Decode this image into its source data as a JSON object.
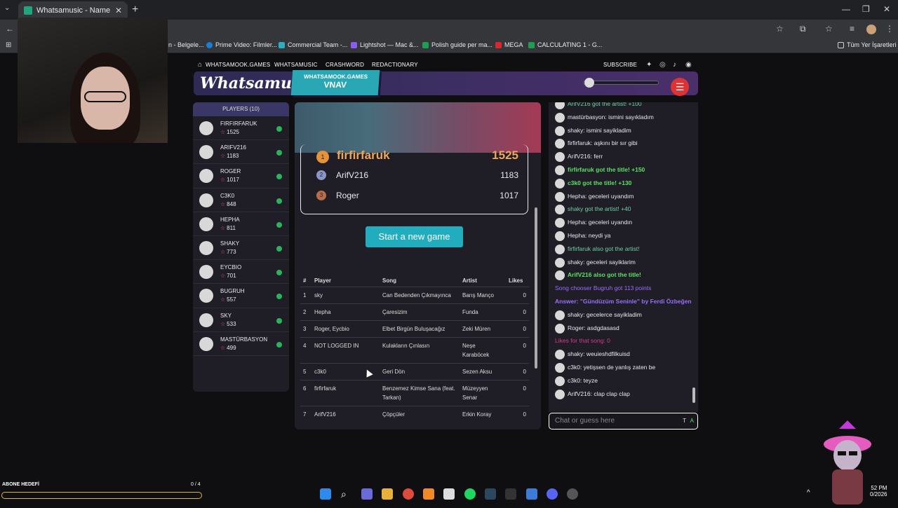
{
  "browser": {
    "tab_title": "Whatsamusic - Name That Tun",
    "new_tab": "+",
    "bookmarks": [
      {
        "label": "n - Belgele..."
      },
      {
        "label": "Prime Video: Filmler..."
      },
      {
        "label": "Commercial Team -..."
      },
      {
        "label": "Lightshot — Mac &..."
      },
      {
        "label": "Polish guide per ma..."
      },
      {
        "label": "MEGA"
      },
      {
        "label": "CALCULATING 1 - G..."
      },
      {
        "label": "Tüm Yer İşaretleri"
      }
    ]
  },
  "site_nav": {
    "links": [
      "WHATSAMOOK.GAMES",
      "WHATSAMUSIC",
      "CRASHWORD",
      "REDACTIONARY"
    ],
    "subscribe": "SUBSCRIBE"
  },
  "header": {
    "logo": "Whatsamusic",
    "room_site": "WHATSAMOOK.GAMES",
    "room_code": "VNAV"
  },
  "players": {
    "title": "PLAYERS (10)",
    "list": [
      {
        "name": "FIRFIRFARUK",
        "score": "1525"
      },
      {
        "name": "ARIFV216",
        "score": "1183"
      },
      {
        "name": "ROGER",
        "score": "1017"
      },
      {
        "name": "C3K0",
        "score": "848"
      },
      {
        "name": "HEPHA",
        "score": "811"
      },
      {
        "name": "SHAKY",
        "score": "773"
      },
      {
        "name": "EYCBIO",
        "score": "701"
      },
      {
        "name": "BUGRUH",
        "score": "557"
      },
      {
        "name": "SKY",
        "score": "533"
      },
      {
        "name": "MASTÜRBASYON",
        "score": "499"
      }
    ]
  },
  "podium": [
    {
      "rank": "1",
      "name": "firfirfaruk",
      "score": "1525"
    },
    {
      "rank": "2",
      "name": "ArifV216",
      "score": "1183"
    },
    {
      "rank": "3",
      "name": "Roger",
      "score": "1017"
    }
  ],
  "start_button": "Start a new game",
  "song_table": {
    "headers": [
      "#",
      "Player",
      "Song",
      "Artist",
      "Likes"
    ],
    "rows": [
      [
        "1",
        "sky",
        "Can Bedenden Çıkmayınca",
        "Barış Manço",
        "0"
      ],
      [
        "2",
        "Hepha",
        "Çaresizim",
        "Funda",
        "0"
      ],
      [
        "3",
        "Roger, Eycbio",
        "Elbet Birgün Buluşacağız",
        "Zeki Müren",
        "0"
      ],
      [
        "4",
        "NOT LOGGED IN",
        "Kulakların Çınlasın",
        "Neşe Karaböcek",
        "0"
      ],
      [
        "5",
        "c3k0",
        "Geri Dön",
        "Sezen Aksu",
        "0"
      ],
      [
        "6",
        "firfirfaruk",
        "Benzemez Kimse Sana (feat. Tarkan)",
        "Müzeyyen Senar",
        "0"
      ],
      [
        "7",
        "ArifV216",
        "Çöpçüler",
        "Erkin Koray",
        "0"
      ]
    ]
  },
  "chat": {
    "messages": [
      {
        "text": "ArifV216 got the artist! +100",
        "style": "lightgreen",
        "avatar": true
      },
      {
        "text": "mastürbasyon: ismini sayıkladım",
        "style": "normal",
        "avatar": true
      },
      {
        "text": "shaky: ismini sayikladim",
        "style": "normal",
        "avatar": true
      },
      {
        "text": "firfirfaruk: aşkını bir sır gibi",
        "style": "normal",
        "avatar": true
      },
      {
        "text": "ArifV216: ferr",
        "style": "normal",
        "avatar": true
      },
      {
        "text": "firfirfaruk got the title! +150",
        "style": "green",
        "avatar": true
      },
      {
        "text": "c3k0 got the title! +130",
        "style": "green",
        "avatar": true
      },
      {
        "text": "Hepha: geceleri uyandım",
        "style": "normal",
        "avatar": true
      },
      {
        "text": "shaky got the artist! +40",
        "style": "lightgreen",
        "avatar": true
      },
      {
        "text": "Hepha: geceleri uyandın",
        "style": "normal",
        "avatar": true
      },
      {
        "text": "Hepha: neydi ya",
        "style": "normal",
        "avatar": true
      },
      {
        "text": "firfirfaruk also got the artist!",
        "style": "lightgreen",
        "avatar": true
      },
      {
        "text": "shaky: geceleri sayiklarim",
        "style": "normal",
        "avatar": true
      },
      {
        "text": "ArifV216 also got the title!",
        "style": "green",
        "avatar": true
      },
      {
        "text": "Song chooser Bugruh got 113 points",
        "style": "purple",
        "avatar": false
      },
      {
        "text": "Answer: \"Gündüzüm Seninle\" by Ferdi Özbeğen",
        "style": "purpleb",
        "avatar": false
      },
      {
        "text": "shaky: gecelerce sayikladim",
        "style": "normal",
        "avatar": true
      },
      {
        "text": "Roger: asdgdasasd",
        "style": "normal",
        "avatar": true
      },
      {
        "text": "Likes for that song: 0",
        "style": "pink",
        "avatar": false
      },
      {
        "text": "shaky: weuieshdfilkuisd",
        "style": "normal",
        "avatar": true
      },
      {
        "text": "c3k0: yetişsen de yanlış zaten be",
        "style": "normal",
        "avatar": true
      },
      {
        "text": "c3k0: teyze",
        "style": "normal",
        "avatar": true
      },
      {
        "text": "ArifV216: clap clap clap",
        "style": "normal",
        "avatar": true
      }
    ],
    "input_placeholder": "Chat or guess here",
    "input_suffix_t": "T",
    "input_suffix_a": "A"
  },
  "stream_overlay": {
    "goal_label": "ABONE HEDEFİ",
    "goal_count": "0 / 4",
    "goal_progress": 0
  },
  "clock": {
    "time": "52 PM",
    "date": "0/2026"
  },
  "colors": {
    "accent": "#22adbe",
    "ok": "#29b35a",
    "star": "#e94d6c",
    "title_green": "#5ce067"
  }
}
